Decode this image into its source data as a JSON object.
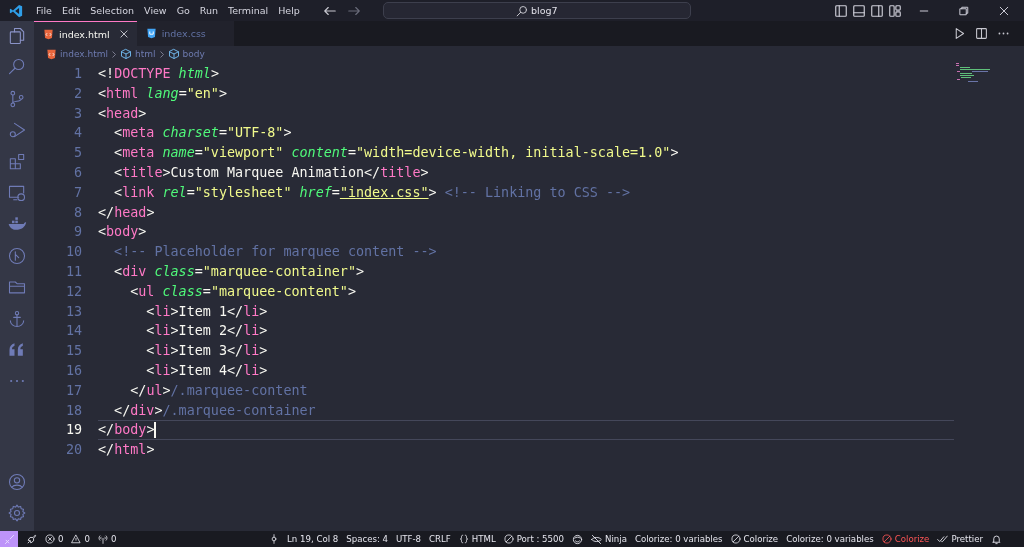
{
  "menu": [
    "File",
    "Edit",
    "Selection",
    "View",
    "Go",
    "Run",
    "Terminal",
    "Help"
  ],
  "search": {
    "value": "blog7"
  },
  "tabs": [
    {
      "label": "index.html",
      "kind": "html",
      "selected": true
    },
    {
      "label": "index.css",
      "kind": "css",
      "selected": false
    }
  ],
  "breadcrumb": [
    {
      "label": "index.html",
      "kind": "file"
    },
    {
      "label": "html",
      "kind": "symbol"
    },
    {
      "label": "body",
      "kind": "symbol"
    }
  ],
  "editor": {
    "lines": [
      {
        "n": "1",
        "current": false,
        "tokens": [
          {
            "kind": "punct",
            "text": "<!"
          },
          {
            "kind": "tag",
            "text": "DOCTYPE"
          },
          {
            "kind": "attr",
            "text": " html"
          },
          {
            "kind": "punct",
            "text": ">"
          }
        ]
      },
      {
        "n": "2",
        "current": false,
        "tokens": [
          {
            "kind": "punct",
            "text": "<"
          },
          {
            "kind": "tag",
            "text": "html"
          },
          {
            "kind": "attr",
            "text": " lang"
          },
          {
            "kind": "punct",
            "text": "="
          },
          {
            "kind": "string",
            "text": "\"en\""
          },
          {
            "kind": "punct",
            "text": ">"
          }
        ]
      },
      {
        "n": "3",
        "current": false,
        "tokens": [
          {
            "kind": "punct",
            "text": "<"
          },
          {
            "kind": "tag",
            "text": "head"
          },
          {
            "kind": "punct",
            "text": ">"
          }
        ]
      },
      {
        "n": "4",
        "current": false,
        "tokens": [
          {
            "kind": "punct",
            "text": "  <"
          },
          {
            "kind": "tag",
            "text": "meta"
          },
          {
            "kind": "attr",
            "text": " charset"
          },
          {
            "kind": "punct",
            "text": "="
          },
          {
            "kind": "string",
            "text": "\"UTF-8\""
          },
          {
            "kind": "punct",
            "text": ">"
          }
        ]
      },
      {
        "n": "5",
        "current": false,
        "tokens": [
          {
            "kind": "punct",
            "text": "  <"
          },
          {
            "kind": "tag",
            "text": "meta"
          },
          {
            "kind": "attr",
            "text": " name"
          },
          {
            "kind": "punct",
            "text": "="
          },
          {
            "kind": "string",
            "text": "\"viewport\""
          },
          {
            "kind": "attr",
            "text": " content"
          },
          {
            "kind": "punct",
            "text": "="
          },
          {
            "kind": "string",
            "text": "\"width=device-width, initial-scale=1.0\""
          },
          {
            "kind": "punct",
            "text": ">"
          }
        ]
      },
      {
        "n": "6",
        "current": false,
        "tokens": [
          {
            "kind": "punct",
            "text": "  <"
          },
          {
            "kind": "tag",
            "text": "title"
          },
          {
            "kind": "punct",
            "text": ">Custom Marquee Animation</"
          },
          {
            "kind": "tag",
            "text": "title"
          },
          {
            "kind": "punct",
            "text": ">"
          }
        ]
      },
      {
        "n": "7",
        "current": false,
        "tokens": [
          {
            "kind": "punct",
            "text": "  <"
          },
          {
            "kind": "tag",
            "text": "link"
          },
          {
            "kind": "attr",
            "text": " rel"
          },
          {
            "kind": "punct",
            "text": "="
          },
          {
            "kind": "string",
            "text": "\"stylesheet\""
          },
          {
            "kind": "attr",
            "text": " href"
          },
          {
            "kind": "punct",
            "text": "="
          },
          {
            "kind": "link",
            "text": "\"index.css\""
          },
          {
            "kind": "punct",
            "text": "> "
          },
          {
            "kind": "comment",
            "text": "<!-- Linking to CSS -->"
          }
        ]
      },
      {
        "n": "8",
        "current": false,
        "tokens": [
          {
            "kind": "punct",
            "text": "</"
          },
          {
            "kind": "tag",
            "text": "head"
          },
          {
            "kind": "punct",
            "text": ">"
          }
        ]
      },
      {
        "n": "9",
        "current": false,
        "tokens": [
          {
            "kind": "punct",
            "text": "<"
          },
          {
            "kind": "tag",
            "text": "body"
          },
          {
            "kind": "punct",
            "text": ">"
          }
        ]
      },
      {
        "n": "10",
        "current": false,
        "tokens": [
          {
            "kind": "comment",
            "text": "  <!-- Placeholder for marquee content -->"
          }
        ]
      },
      {
        "n": "11",
        "current": false,
        "tokens": [
          {
            "kind": "punct",
            "text": "  <"
          },
          {
            "kind": "tag",
            "text": "div"
          },
          {
            "kind": "attr",
            "text": " class"
          },
          {
            "kind": "punct",
            "text": "="
          },
          {
            "kind": "string",
            "text": "\"marquee-container\""
          },
          {
            "kind": "punct",
            "text": ">"
          }
        ]
      },
      {
        "n": "12",
        "current": false,
        "tokens": [
          {
            "kind": "punct",
            "text": "    <"
          },
          {
            "kind": "tag",
            "text": "ul"
          },
          {
            "kind": "attr",
            "text": " class"
          },
          {
            "kind": "punct",
            "text": "="
          },
          {
            "kind": "string",
            "text": "\"marquee-content\""
          },
          {
            "kind": "punct",
            "text": ">"
          }
        ]
      },
      {
        "n": "13",
        "current": false,
        "tokens": [
          {
            "kind": "punct",
            "text": "      <"
          },
          {
            "kind": "tag",
            "text": "li"
          },
          {
            "kind": "punct",
            "text": ">Item 1</"
          },
          {
            "kind": "tag",
            "text": "li"
          },
          {
            "kind": "punct",
            "text": ">"
          }
        ]
      },
      {
        "n": "14",
        "current": false,
        "tokens": [
          {
            "kind": "punct",
            "text": "      <"
          },
          {
            "kind": "tag",
            "text": "li"
          },
          {
            "kind": "punct",
            "text": ">Item 2</"
          },
          {
            "kind": "tag",
            "text": "li"
          },
          {
            "kind": "punct",
            "text": ">"
          }
        ]
      },
      {
        "n": "15",
        "current": false,
        "tokens": [
          {
            "kind": "punct",
            "text": "      <"
          },
          {
            "kind": "tag",
            "text": "li"
          },
          {
            "kind": "punct",
            "text": ">Item 3</"
          },
          {
            "kind": "tag",
            "text": "li"
          },
          {
            "kind": "punct",
            "text": ">"
          }
        ]
      },
      {
        "n": "16",
        "current": false,
        "tokens": [
          {
            "kind": "punct",
            "text": "      <"
          },
          {
            "kind": "tag",
            "text": "li"
          },
          {
            "kind": "punct",
            "text": ">Item 4</"
          },
          {
            "kind": "tag",
            "text": "li"
          },
          {
            "kind": "punct",
            "text": ">"
          }
        ]
      },
      {
        "n": "17",
        "current": false,
        "tokens": [
          {
            "kind": "punct",
            "text": "    </"
          },
          {
            "kind": "tag",
            "text": "ul"
          },
          {
            "kind": "punct",
            "text": ">"
          },
          {
            "kind": "comment",
            "text": "/.marquee-content"
          }
        ]
      },
      {
        "n": "18",
        "current": false,
        "tokens": [
          {
            "kind": "punct",
            "text": "  </"
          },
          {
            "kind": "tag",
            "text": "div"
          },
          {
            "kind": "punct",
            "text": ">"
          },
          {
            "kind": "comment",
            "text": "/.marquee-container"
          }
        ]
      },
      {
        "n": "19",
        "current": true,
        "tokens": [
          {
            "kind": "punct",
            "text": "</"
          },
          {
            "kind": "tag",
            "text": "body"
          },
          {
            "kind": "punct",
            "text": ">"
          }
        ]
      },
      {
        "n": "20",
        "current": false,
        "tokens": [
          {
            "kind": "punct",
            "text": "</"
          },
          {
            "kind": "tag",
            "text": "html"
          },
          {
            "kind": "punct",
            "text": ">"
          }
        ]
      }
    ]
  },
  "status_left": [
    {
      "text": "0"
    },
    {
      "text": "0"
    },
    {
      "text": "0"
    }
  ],
  "status_right": [
    {
      "text": "Ln 19, Col 8"
    },
    {
      "text": "Spaces: 4"
    },
    {
      "text": "UTF-8"
    },
    {
      "text": "CRLF"
    },
    {
      "text": "HTML"
    },
    {
      "text": "Port : 5500"
    },
    {
      "text": "Ninja"
    },
    {
      "text": "Colorize: 0 variables"
    },
    {
      "text": "Colorize"
    },
    {
      "text": "Colorize: 0 variables"
    },
    {
      "text": "Colorize",
      "kind": "error"
    },
    {
      "text": "Prettier"
    }
  ]
}
